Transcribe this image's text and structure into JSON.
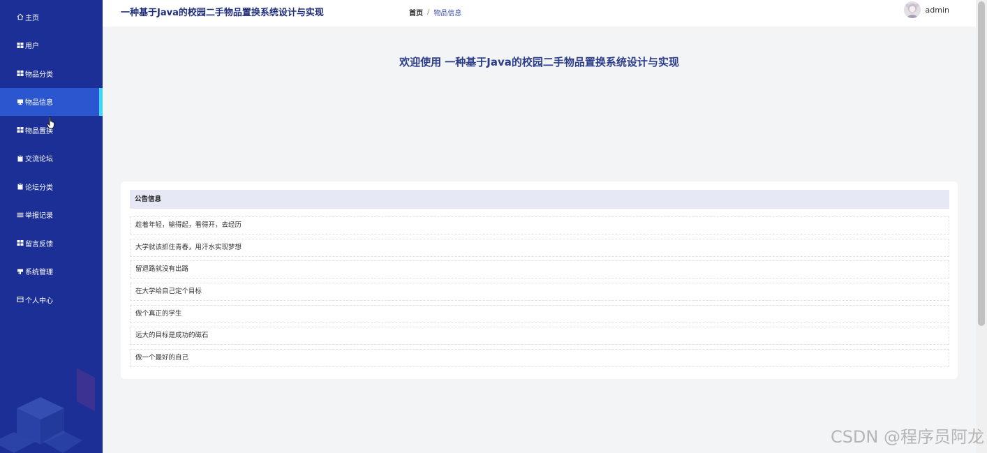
{
  "app": {
    "title": "一种基于Java的校园二手物品置换系统设计与实现"
  },
  "breadcrumb": {
    "home": "首页",
    "separator": "/",
    "current": "物品信息"
  },
  "user": {
    "name": "admin"
  },
  "sidebar": {
    "items": [
      {
        "label": "主页",
        "icon": "home-icon"
      },
      {
        "label": "用户",
        "icon": "grid-icon"
      },
      {
        "label": "物品分类",
        "icon": "grid-icon"
      },
      {
        "label": "物品信息",
        "icon": "monitor-icon",
        "active": true
      },
      {
        "label": "物品置换",
        "icon": "grid-icon"
      },
      {
        "label": "交流论坛",
        "icon": "clipboard-icon"
      },
      {
        "label": "论坛分类",
        "icon": "clipboard-icon"
      },
      {
        "label": "举报记录",
        "icon": "list-icon"
      },
      {
        "label": "留言反馈",
        "icon": "grid-icon"
      },
      {
        "label": "系统管理",
        "icon": "settings-icon"
      },
      {
        "label": "个人中心",
        "icon": "id-card-icon"
      }
    ]
  },
  "welcome": {
    "text": "欢迎使用 一种基于Java的校园二手物品置换系统设计与实现"
  },
  "notice": {
    "title": "公告信息",
    "items": [
      "趁着年轻，输得起，看得开，去经历",
      "大学就该抓住青春，用汗水实现梦想",
      "留退路就没有出路",
      "在大学给自己定个目标",
      "做个真正的学生",
      "远大的目标是成功的磁石",
      "做一个最好的自己"
    ]
  },
  "watermark": "CSDN @程序员阿龙",
  "colors": {
    "sidebar_bg": "#1b2f96",
    "sidebar_active": "#2a56d0",
    "active_indicator": "#3fd8f5",
    "title_color": "#1e2d7a",
    "notice_header_bg": "#e6e8f5"
  }
}
